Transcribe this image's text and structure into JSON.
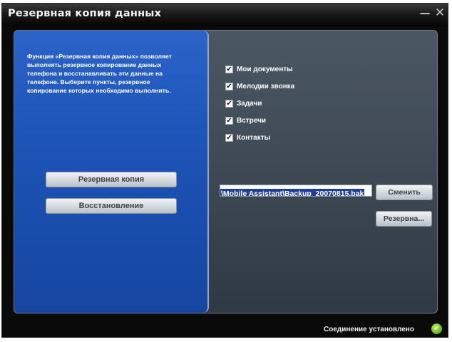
{
  "window": {
    "title": "Резервная копия данных",
    "minimize_glyph": "—",
    "close_glyph": "✕"
  },
  "left_panel": {
    "description": "Функция «Резервная копия данных» позволяет выполнять резервное копирование данных телефона и восстанавливать эти данные на телефоне. Выберите пункты, резервное копирование которых необходимо выполнить.",
    "backup_button": "Резервная копия",
    "restore_button": "Восстановление"
  },
  "items": [
    {
      "label": "Мои документы",
      "checked": true
    },
    {
      "label": "Мелодии звонка",
      "checked": true
    },
    {
      "label": "Задачи",
      "checked": true
    },
    {
      "label": "Встречи",
      "checked": true
    },
    {
      "label": "Контакты",
      "checked": true
    }
  ],
  "check_glyph": "✔",
  "path": {
    "value": "\\Mobile Assistant\\Backup_20070815.bak",
    "change_button": "Сменить",
    "browse_button": "Резервна..."
  },
  "status": {
    "text": "Соединение установлено",
    "icon": "check-circle-icon",
    "icon_glyph": "✔",
    "color": "#6fbe23"
  },
  "colors": {
    "left_panel": "#1e55b8",
    "content_bg": "#3b4651",
    "window_bg": "#0a0a0a"
  }
}
